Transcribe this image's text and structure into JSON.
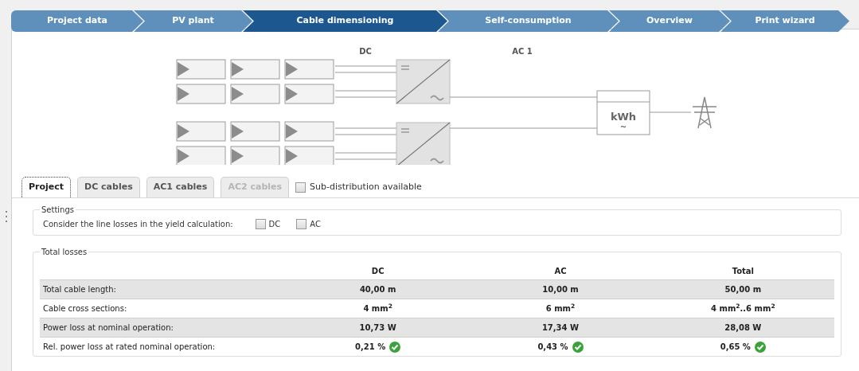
{
  "steps": [
    {
      "label": "Project data",
      "selected": false
    },
    {
      "label": "PV plant",
      "selected": false
    },
    {
      "label": "Cable dimensioning",
      "selected": true
    },
    {
      "label": "Self-consumption",
      "selected": false
    },
    {
      "label": "Overview",
      "selected": false
    },
    {
      "label": "Print wizard",
      "selected": false
    }
  ],
  "diagram": {
    "dc_label": "DC",
    "ac_label": "AC 1",
    "meter_label": "kWh",
    "meter_symbol": "~"
  },
  "tabs": [
    {
      "label": "Project",
      "selected": true,
      "disabled": false
    },
    {
      "label": "DC cables",
      "selected": false,
      "disabled": false
    },
    {
      "label": "AC1 cables",
      "selected": false,
      "disabled": false
    },
    {
      "label": "AC2 cables",
      "selected": false,
      "disabled": true
    }
  ],
  "sub_distribution": {
    "label": "Sub-distribution available",
    "checked": false
  },
  "settings": {
    "title": "Settings",
    "label": "Consider the line losses in the yield calculation:",
    "options": [
      {
        "label": "DC",
        "checked": false
      },
      {
        "label": "AC",
        "checked": false
      }
    ]
  },
  "total_losses": {
    "title": "Total losses",
    "columns": [
      "DC",
      "AC",
      "Total"
    ],
    "rows": [
      {
        "label": "Total cable length:",
        "cells": [
          {
            "text": "40,00 m",
            "ok": false
          },
          {
            "text": "10,00 m",
            "ok": false
          },
          {
            "text": "50,00 m",
            "ok": false
          }
        ]
      },
      {
        "label": "Cable cross sections:",
        "cells": [
          {
            "text": "4 mm$^{2}$",
            "ok": false
          },
          {
            "text": "6 mm$^{2}$",
            "ok": false
          },
          {
            "text": "4 mm$^{2}$..6 mm$^{2}$",
            "ok": false
          }
        ]
      },
      {
        "label": "Power loss at nominal operation:",
        "cells": [
          {
            "text": "10,73 W",
            "ok": false
          },
          {
            "text": "17,34 W",
            "ok": false
          },
          {
            "text": "28,08 W",
            "ok": false
          }
        ]
      },
      {
        "label": "Rel. power loss at rated nominal operation:",
        "cells": [
          {
            "text": "0,21 %",
            "ok": true
          },
          {
            "text": "0,43 %",
            "ok": true
          },
          {
            "text": "0,65 %",
            "ok": true
          }
        ]
      }
    ]
  }
}
